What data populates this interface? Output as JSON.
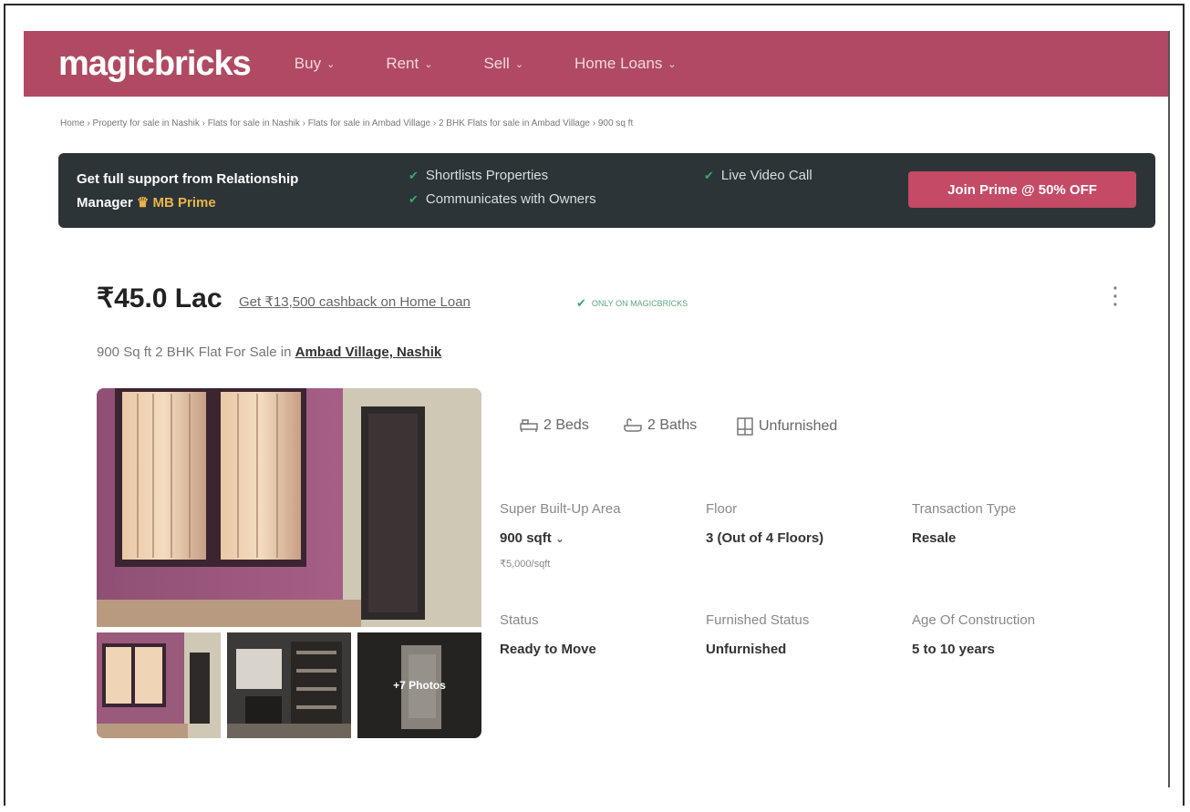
{
  "header": {
    "logo": "magicbricks",
    "nav": [
      {
        "label": "Buy"
      },
      {
        "label": "Rent"
      },
      {
        "label": "Sell"
      },
      {
        "label": "Home Loans"
      }
    ],
    "brand_color": "#b04a63"
  },
  "breadcrumb": "Home › Property for sale in Nashik › Flats for sale in Nashik › Flats for sale in Ambad Village › 2 BHK Flats for sale in Ambad Village › 900 sq ft",
  "prime": {
    "title_line1": "Get full support from Relationship",
    "title_line2_prefix": "Manager",
    "title_badge": "MB Prime",
    "features": [
      "Shortlists Properties",
      "Communicates with Owners",
      "Live Video Call"
    ],
    "join_label": "Join Prime @ 50% OFF"
  },
  "listing": {
    "price": "₹45.0 Lac",
    "cashback": "Get ₹13,500 cashback on Home Loan",
    "only_on": "ONLY ON MAGICBRICKS",
    "subtitle_prefix": "900 Sq ft 2 BHK Flat For Sale in",
    "location": "Ambad Village, Nashik",
    "more_photos": "+7 Photos",
    "amenities": {
      "beds": "2 Beds",
      "baths": "2 Baths",
      "furnishing": "Unfurnished"
    },
    "details": {
      "area_label": "Super Built-Up Area",
      "area_value": "900 sqft",
      "area_rate": "₹5,000/sqft",
      "floor_label": "Floor",
      "floor_value": "3 (Out of 4 Floors)",
      "transaction_label": "Transaction Type",
      "transaction_value": "Resale",
      "status_label": "Status",
      "status_value": "Ready to Move",
      "furnished_label": "Furnished Status",
      "furnished_value": "Unfurnished",
      "age_label": "Age Of Construction",
      "age_value": "5 to 10 years"
    }
  }
}
